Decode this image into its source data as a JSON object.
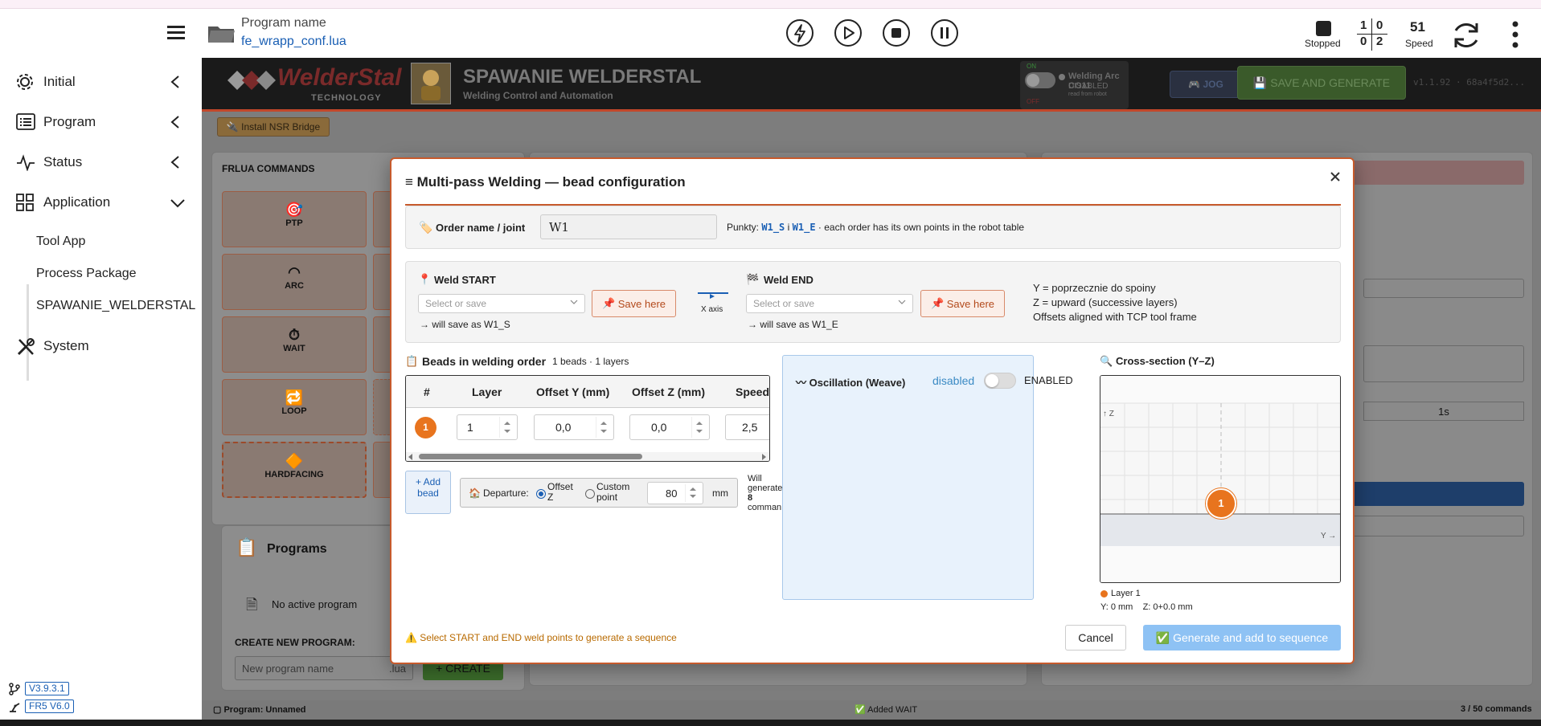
{
  "topbar": {
    "program_label": "Program name",
    "program_file": "fe_wrapp_conf.lua",
    "status_label": "Stopped",
    "counter": [
      "1",
      "0",
      "0",
      "2"
    ],
    "speed_value": "51",
    "speed_label": "Speed"
  },
  "sidebar": {
    "items": [
      {
        "label": "Initial"
      },
      {
        "label": "Program"
      },
      {
        "label": "Status"
      },
      {
        "label": "Application"
      },
      {
        "label": "System"
      }
    ],
    "sub_items": [
      "Tool App",
      "Process Package",
      "SPAWANIE_WELDERSTAL"
    ],
    "versions": [
      "V3.9.3.1",
      "FR5 V6.0"
    ]
  },
  "header": {
    "logo_text": "WelderStal",
    "logo_sub": "TECHNOLOGY",
    "title": "SPAWANIE WELDERSTAL",
    "subtitle": "Welding Control and Automation",
    "toggle_on": "ON",
    "toggle_off": "OFF",
    "arc_name": "Welding Arc CO11",
    "arc_state": "DISABLED",
    "arc_note": "read from robot",
    "jog_label": "JOG",
    "save_generate_label": "SAVE AND GENERATE",
    "version_text": "v1.1.92 · 68a4f5d2..."
  },
  "background": {
    "install_btn": "Install NSR Bridge",
    "commands_title": "FRLUA COMMANDS",
    "commands": [
      "PTP",
      "ARC",
      "WAIT",
      "LOOP",
      "HARDFACING"
    ],
    "programs_title": "Programs",
    "no_program": "No active program",
    "create_label": "CREATE NEW PROGRAM:",
    "program_placeholder": "New program name",
    "ext": ".lua",
    "create_btn": "+ CREATE",
    "right_value": "1s",
    "status_left": "Program: Unnamed",
    "status_mid": "Added WAIT",
    "status_right": "3 / 50 commands"
  },
  "modal": {
    "title": "≡ Multi-pass Welding — bead configuration",
    "order_label": "Order name / joint",
    "order_value": "W1",
    "points_prefix": "Punkty:",
    "point_s": "W1_S",
    "points_and": "i",
    "point_e": "W1_E",
    "points_suffix": "· each order has its own points in the robot table",
    "weld_start": "Weld START",
    "weld_end": "Weld END",
    "select_placeholder": "Select or save",
    "save_here": "Save here",
    "x_axis": "X axis",
    "save_as_s": "→ will save as W1_S",
    "save_as_e": "→ will save as W1_E",
    "notes": [
      "Y = poprzecznie do spoiny",
      "Z = upward (successive layers)",
      "Offsets aligned with TCP tool frame"
    ],
    "beads_title": "Beads in welding order",
    "beads_meta": "1 beads · 1 layers",
    "table": {
      "headers": [
        "#",
        "Layer",
        "Offset Y (mm)",
        "Offset Z (mm)",
        "Speed"
      ],
      "rows": [
        {
          "num": "1",
          "layer": "1",
          "offset_y": "0,0",
          "offset_z": "0,0",
          "speed": "2,5"
        }
      ]
    },
    "add_bead": "+ Add bead",
    "departure_label": "Departure:",
    "radio_offset": "Offset Z",
    "radio_custom": "Custom point",
    "departure_value": "80",
    "departure_unit": "mm",
    "will_generate": [
      "Will",
      "generate",
      "8",
      "comman"
    ],
    "osc_title": "Oscillation (Weave)",
    "osc_state": "disabled",
    "osc_enabled": "ENABLED",
    "cross_title": "Cross-section (Y–Z)",
    "axis_z": "↑ Z",
    "axis_y": "Y →",
    "bead_label": "1",
    "legend": "Layer 1",
    "legend_values": "Y: 0 mm    Z: 0+0.0 mm",
    "warning": "⚠️ Select START and END weld points to generate a sequence",
    "cancel": "Cancel",
    "generate": "✅ Generate and add to sequence"
  },
  "colors": {
    "accent": "#e8741e",
    "brand_red": "#c2472a",
    "link": "#1a5fb4",
    "green": "#5a8a3a"
  }
}
